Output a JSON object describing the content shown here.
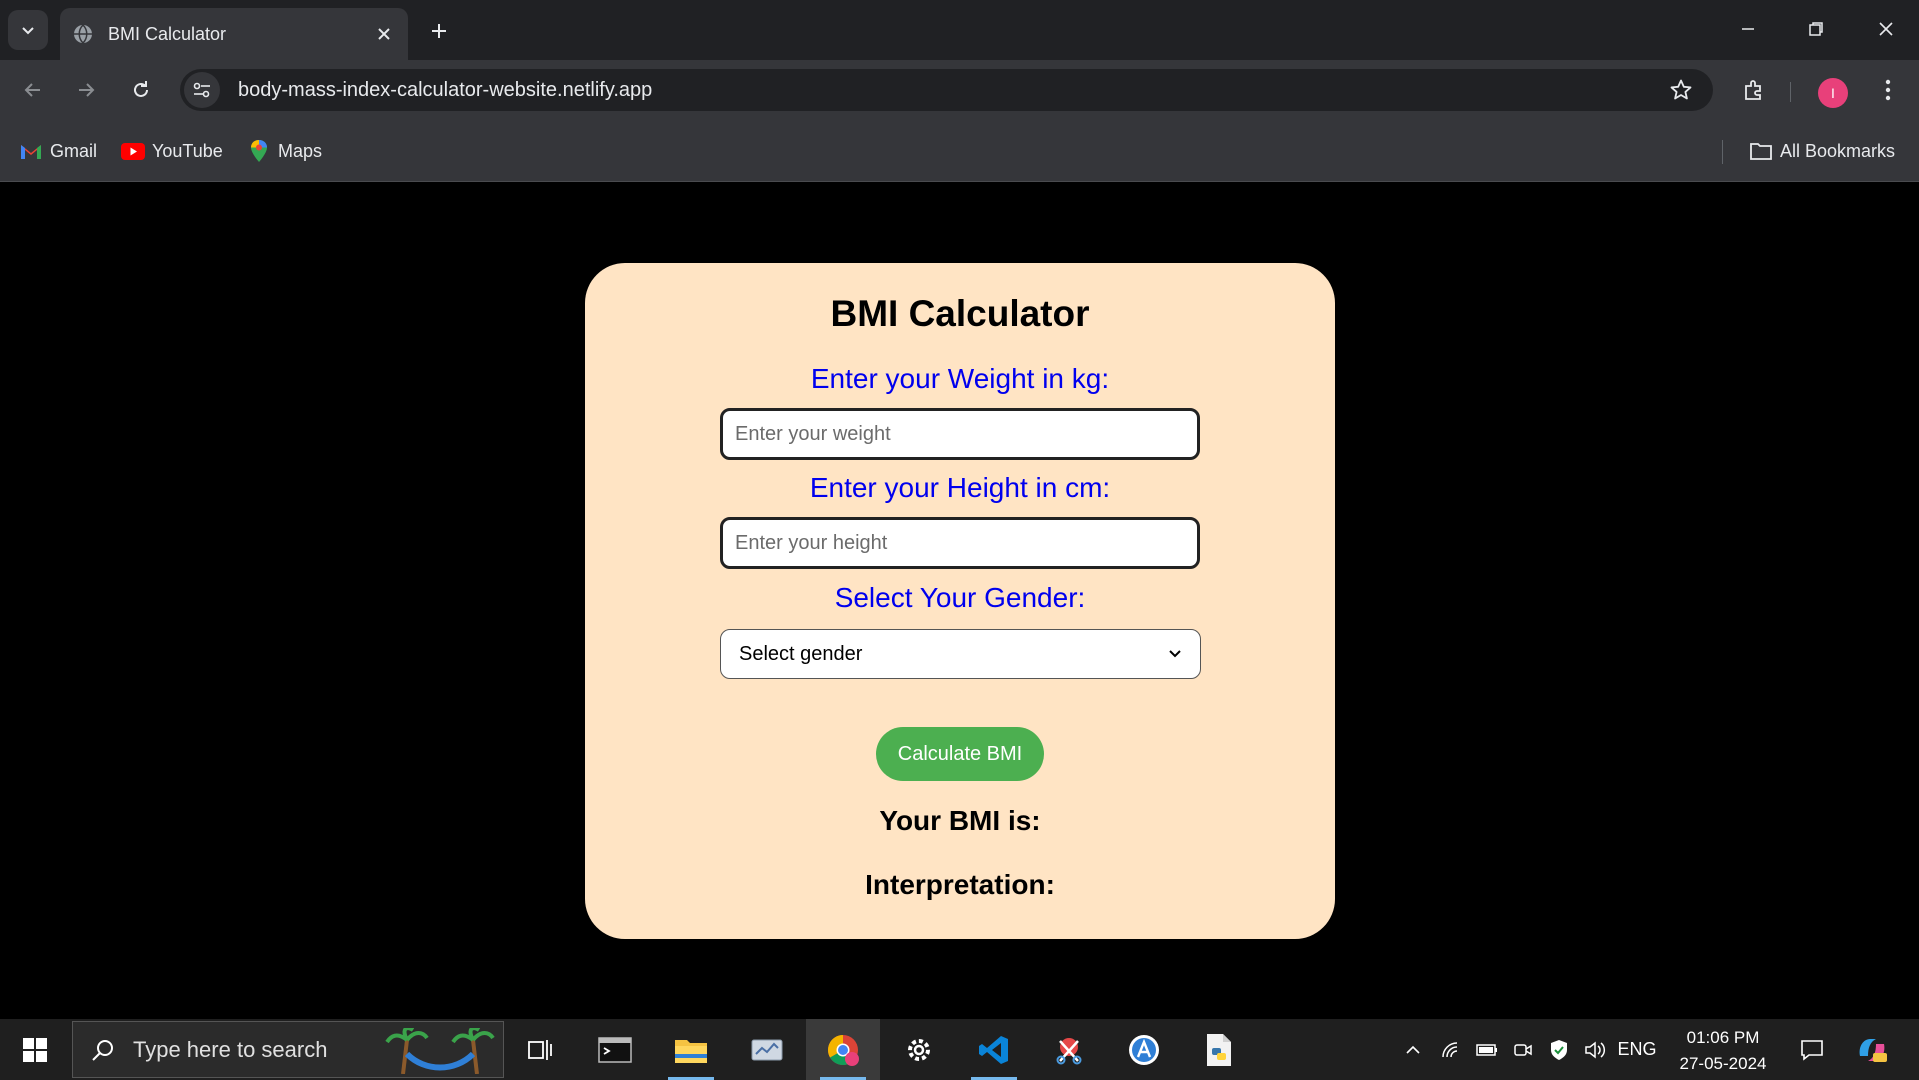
{
  "browser": {
    "tab_title": "BMI Calculator",
    "url": "body-mass-index-calculator-website.netlify.app",
    "avatar_letter": "I",
    "bookmarks": [
      {
        "label": "Gmail",
        "icon": "gmail-icon"
      },
      {
        "label": "YouTube",
        "icon": "youtube-icon"
      },
      {
        "label": "Maps",
        "icon": "maps-icon"
      }
    ],
    "all_bookmarks_label": "All Bookmarks"
  },
  "page": {
    "title": "BMI Calculator",
    "weight_label": "Enter your Weight in kg:",
    "weight_placeholder": "Enter your weight",
    "height_label": "Enter your Height in cm:",
    "height_placeholder": "Enter your height",
    "gender_label": "Select Your Gender:",
    "gender_selected": "Select gender",
    "calculate_label": "Calculate BMI",
    "bmi_result_label": "Your BMI is:",
    "interpretation_label": "Interpretation:"
  },
  "taskbar": {
    "search_placeholder": "Type here to search",
    "language": "ENG",
    "time": "01:06 PM",
    "date": "27-05-2024"
  },
  "colors": {
    "card_bg": "#ffe4c4",
    "label_blue": "#0000ee",
    "button_green": "#4caf50",
    "page_bg": "#000000"
  }
}
